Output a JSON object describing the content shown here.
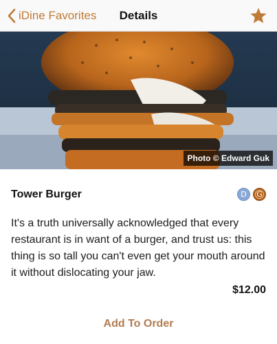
{
  "nav": {
    "back_label": "iDine Favorites",
    "title": "Details",
    "favorite_icon": "star-icon"
  },
  "hero": {
    "credit": "Photo © Edward Guk"
  },
  "item": {
    "name": "Tower Burger",
    "restrictions": [
      "D",
      "G"
    ],
    "description": "It's a truth universally acknowledged that every restaurant is in want of a burger, and trust us: this thing is so tall you can't even get your mouth around it without dislocating your jaw.",
    "price": "$12.00"
  },
  "actions": {
    "add_label": "Add To Order"
  },
  "colors": {
    "accent": "#c07a35",
    "restriction_d": "#8aa9d8",
    "restriction_g": "#b5621c"
  }
}
